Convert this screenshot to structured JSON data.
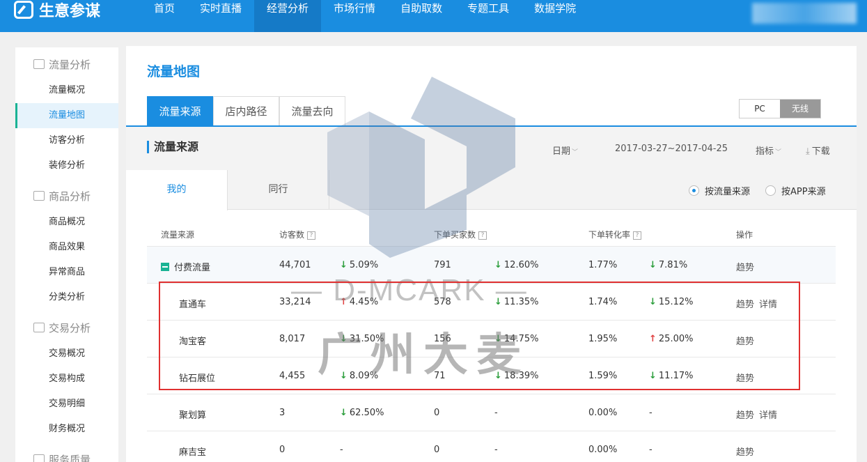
{
  "app": {
    "logo_text": "生意参谋"
  },
  "nav": {
    "items": [
      "首页",
      "实时直播",
      "经营分析",
      "市场行情",
      "自助取数",
      "专题工具",
      "数据学院"
    ],
    "active": "经营分析"
  },
  "sidebar": {
    "groups": [
      {
        "title": "流量分析",
        "icon": "bar-chart-icon",
        "items": [
          "流量概况",
          "流量地图",
          "访客分析",
          "装修分析"
        ]
      },
      {
        "title": "商品分析",
        "icon": "bag-icon",
        "items": [
          "商品概况",
          "商品效果",
          "异常商品",
          "分类分析"
        ]
      },
      {
        "title": "交易分析",
        "icon": "cart-icon",
        "items": [
          "交易概况",
          "交易构成",
          "交易明细",
          "财务概况"
        ]
      },
      {
        "title": "服务质量",
        "icon": "headset-icon",
        "items": []
      }
    ],
    "active_item": "流量地图"
  },
  "page": {
    "title": "流量地图",
    "tabs": [
      "流量来源",
      "店内路径",
      "流量去向"
    ],
    "device": {
      "options": [
        "PC",
        "无线"
      ],
      "selected": "无线"
    },
    "section_title": "流量来源",
    "date_label": "日期",
    "date_range": "2017-03-27~2017-04-25",
    "metric_label": "指标",
    "download_label": "下载",
    "subtabs": [
      "我的",
      "同行"
    ],
    "radios": [
      {
        "label": "按流量来源",
        "checked": true
      },
      {
        "label": "按APP来源",
        "checked": false
      }
    ]
  },
  "table": {
    "headers": [
      "流量来源",
      "访客数",
      "下单买家数",
      "下单转化率",
      "操作"
    ],
    "help_mark": "?",
    "rows": [
      {
        "source": "付费流量",
        "visitors": "44,701",
        "v_change": "5.09%",
        "v_dir": "down",
        "buyers": "791",
        "b_change": "12.60%",
        "b_dir": "down",
        "rate": "1.77%",
        "r_change": "7.81%",
        "r_dir": "down",
        "ops": [
          "趋势"
        ],
        "group": true
      },
      {
        "source": "直通车",
        "visitors": "33,214",
        "v_change": "4.45%",
        "v_dir": "up",
        "buyers": "578",
        "b_change": "11.35%",
        "b_dir": "down",
        "rate": "1.74%",
        "r_change": "15.12%",
        "r_dir": "down",
        "ops": [
          "趋势",
          "详情"
        ]
      },
      {
        "source": "淘宝客",
        "visitors": "8,017",
        "v_change": "31.50%",
        "v_dir": "down",
        "buyers": "156",
        "b_change": "14.75%",
        "b_dir": "down",
        "rate": "1.95%",
        "r_change": "25.00%",
        "r_dir": "up",
        "ops": [
          "趋势"
        ]
      },
      {
        "source": "钻石展位",
        "visitors": "4,455",
        "v_change": "8.09%",
        "v_dir": "down",
        "buyers": "71",
        "b_change": "18.39%",
        "b_dir": "down",
        "rate": "1.59%",
        "r_change": "11.17%",
        "r_dir": "down",
        "ops": [
          "趋势"
        ]
      },
      {
        "source": "聚划算",
        "visitors": "3",
        "v_change": "62.50%",
        "v_dir": "down",
        "buyers": "0",
        "b_change": "-",
        "b_dir": "none",
        "rate": "0.00%",
        "r_change": "-",
        "r_dir": "none",
        "ops": [
          "趋势",
          "详情"
        ]
      },
      {
        "source": "麻吉宝",
        "visitors": "0",
        "v_change": "-",
        "v_dir": "none",
        "buyers": "0",
        "b_change": "-",
        "b_dir": "none",
        "rate": "0.00%",
        "r_change": "-",
        "r_dir": "none",
        "ops": [
          "趋势"
        ]
      }
    ]
  },
  "watermark": {
    "line1": "— D-MCARK —",
    "line2": "广州大麦"
  },
  "colors": {
    "brand": "#1a8de0",
    "accent_green": "#1ab394",
    "down": "#2a9d3a",
    "up": "#e04040",
    "highlight": "#e03030"
  }
}
